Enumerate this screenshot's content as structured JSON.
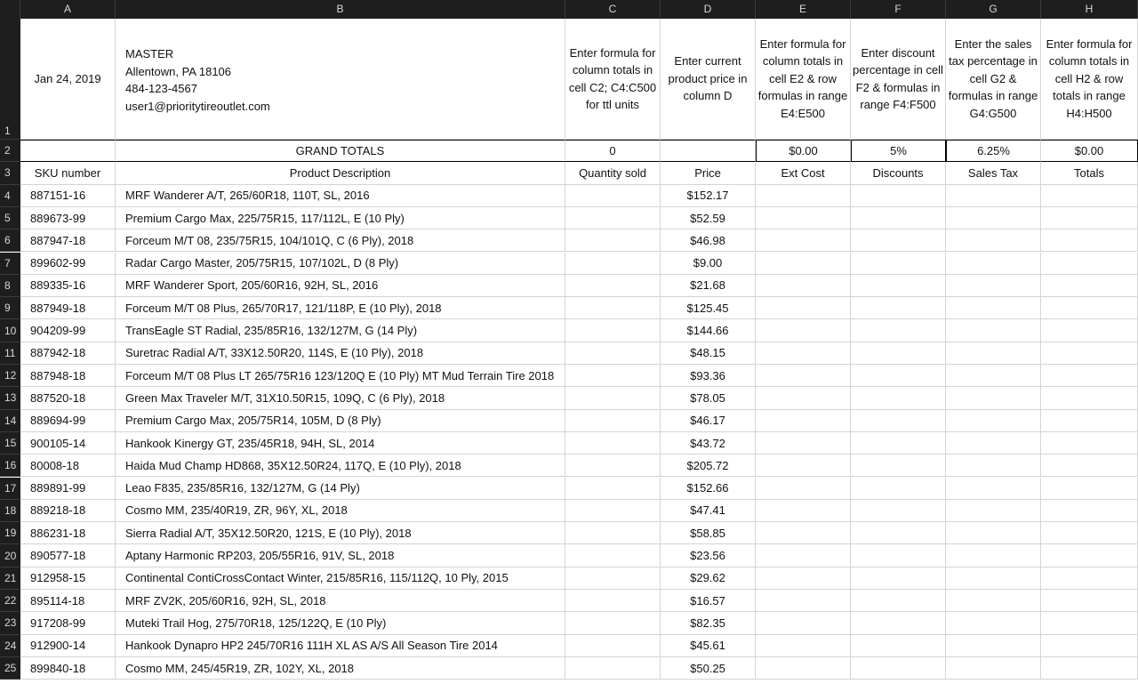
{
  "columns": [
    "A",
    "B",
    "C",
    "D",
    "E",
    "F",
    "G",
    "H"
  ],
  "row_numbers": [
    "1",
    "2",
    "3",
    "4",
    "5",
    "6",
    "7",
    "8",
    "9",
    "10",
    "11",
    "12",
    "13",
    "14",
    "15",
    "16",
    "17",
    "18",
    "19",
    "20",
    "21",
    "22",
    "23",
    "24",
    "25"
  ],
  "row1": {
    "date": "Jan 24, 2019",
    "master": [
      "MASTER",
      "Allentown, PA  18106",
      "484-123-4567",
      "user1@prioritytireoutlet.com"
    ],
    "c": "Enter formula for column totals in cell C2; C4:C500 for ttl units",
    "d": "Enter current product price in column D",
    "e": "Enter formula for column totals in cell E2 & row formulas in range E4:E500",
    "f": "Enter discount percentage in cell F2 & formulas in range F4:F500",
    "g": "Enter the sales tax percentage in cell G2 & formulas in range G4:G500",
    "h": "Enter formula for column totals in cell H2 & row totals in range H4:H500"
  },
  "row2": {
    "label": "GRAND TOTALS",
    "quantity": "0",
    "ext_cost": "$0.00",
    "discount": "5%",
    "sales_tax": "6.25%",
    "total": "$0.00"
  },
  "headers": [
    "SKU number",
    "Product Description",
    "Quantity sold",
    "Price",
    "Ext Cost",
    "Discounts",
    "Sales Tax",
    "Totals"
  ],
  "products": [
    {
      "sku": "887151-16",
      "desc": "MRF Wanderer A/T, 265/60R18, 110T, SL, 2016",
      "price": "$152.17"
    },
    {
      "sku": "889673-99",
      "desc": "Premium Cargo Max, 225/75R15, 117/112L, E (10 Ply)",
      "price": "$52.59"
    },
    {
      "sku": "887947-18",
      "desc": "Forceum M/T 08, 235/75R15, 104/101Q, C (6 Ply), 2018",
      "price": "$46.98"
    },
    {
      "sku": "899602-99",
      "desc": "Radar Cargo Master, 205/75R15, 107/102L, D (8 Ply)",
      "price": "$9.00"
    },
    {
      "sku": "889335-16",
      "desc": "MRF Wanderer Sport, 205/60R16, 92H, SL, 2016",
      "price": "$21.68"
    },
    {
      "sku": "887949-18",
      "desc": "Forceum M/T 08 Plus, 265/70R17, 121/118P, E (10 Ply), 2018",
      "price": "$125.45"
    },
    {
      "sku": "904209-99",
      "desc": "TransEagle ST Radial, 235/85R16, 132/127M, G (14 Ply)",
      "price": "$144.66"
    },
    {
      "sku": "887942-18",
      "desc": "Suretrac Radial A/T, 33X12.50R20, 114S, E (10 Ply), 2018",
      "price": "$48.15"
    },
    {
      "sku": "887948-18",
      "desc": "Forceum M/T 08 Plus LT 265/75R16 123/120Q E (10 Ply) MT Mud Terrain Tire 2018",
      "price": "$93.36"
    },
    {
      "sku": "887520-18",
      "desc": "Green Max Traveler M/T, 31X10.50R15, 109Q, C (6 Ply), 2018",
      "price": "$78.05"
    },
    {
      "sku": "889694-99",
      "desc": "Premium Cargo Max, 205/75R14, 105M, D (8 Ply)",
      "price": "$46.17"
    },
    {
      "sku": "900105-14",
      "desc": "Hankook Kinergy GT, 235/45R18, 94H, SL, 2014",
      "price": "$43.72"
    },
    {
      "sku": "80008-18",
      "desc": "Haida Mud Champ HD868, 35X12.50R24, 117Q, E (10 Ply), 2018",
      "price": "$205.72"
    },
    {
      "sku": "889891-99",
      "desc": "Leao F835, 235/85R16, 132/127M, G (14 Ply)",
      "price": "$152.66"
    },
    {
      "sku": "889218-18",
      "desc": "Cosmo MM, 235/40R19, ZR, 96Y, XL, 2018",
      "price": "$47.41"
    },
    {
      "sku": "886231-18",
      "desc": "Sierra Radial A/T, 35X12.50R20, 121S, E (10 Ply), 2018",
      "price": "$58.85"
    },
    {
      "sku": "890577-18",
      "desc": "Aptany Harmonic RP203, 205/55R16, 91V, SL, 2018",
      "price": "$23.56"
    },
    {
      "sku": "912958-15",
      "desc": "Continental ContiCrossContact Winter, 215/85R16, 115/112Q, 10 Ply, 2015",
      "price": "$29.62"
    },
    {
      "sku": "895114-18",
      "desc": "MRF ZV2K, 205/60R16, 92H, SL, 2018",
      "price": "$16.57"
    },
    {
      "sku": "917208-99",
      "desc": "Muteki Trail Hog, 275/70R18, 125/122Q, E (10 Ply)",
      "price": "$82.35"
    },
    {
      "sku": "912900-14",
      "desc": "Hankook Dynapro HP2 245/70R16 111H XL AS A/S All Season Tire 2014",
      "price": "$45.61"
    },
    {
      "sku": "899840-18",
      "desc": "Cosmo MM, 245/45R19, ZR, 102Y, XL, 2018",
      "price": "$50.25"
    }
  ]
}
